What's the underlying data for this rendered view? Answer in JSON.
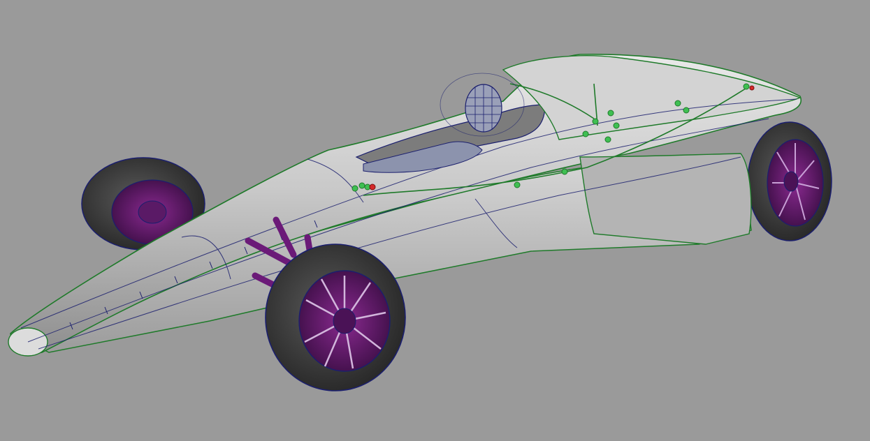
{
  "viewport": {
    "background": "#9a9a9a",
    "scene": "3d-car-model-wireframe",
    "colors": {
      "body_surface": "#bdbdbd",
      "body_highlight": "#e6e6e6",
      "curve_green": "#1f7a2a",
      "isoparm_blue": "#1b1f6e",
      "rim_purple": "#6b1a78",
      "tire": "#3a3a3a",
      "control_point_green": "#3fbf52",
      "selected_red": "#d42a2a"
    },
    "objects": [
      {
        "name": "chassis-body",
        "icon": "nurbs-surface"
      },
      {
        "name": "driver-figure",
        "icon": "wireframe-mesh"
      },
      {
        "name": "front-left-wheel",
        "icon": "wheel"
      },
      {
        "name": "front-right-wheel",
        "icon": "wheel"
      },
      {
        "name": "rear-left-wheel",
        "icon": "wheel"
      },
      {
        "name": "rear-right-wheel",
        "icon": "wheel"
      },
      {
        "name": "suspension-struts",
        "icon": "cylinder"
      }
    ]
  }
}
